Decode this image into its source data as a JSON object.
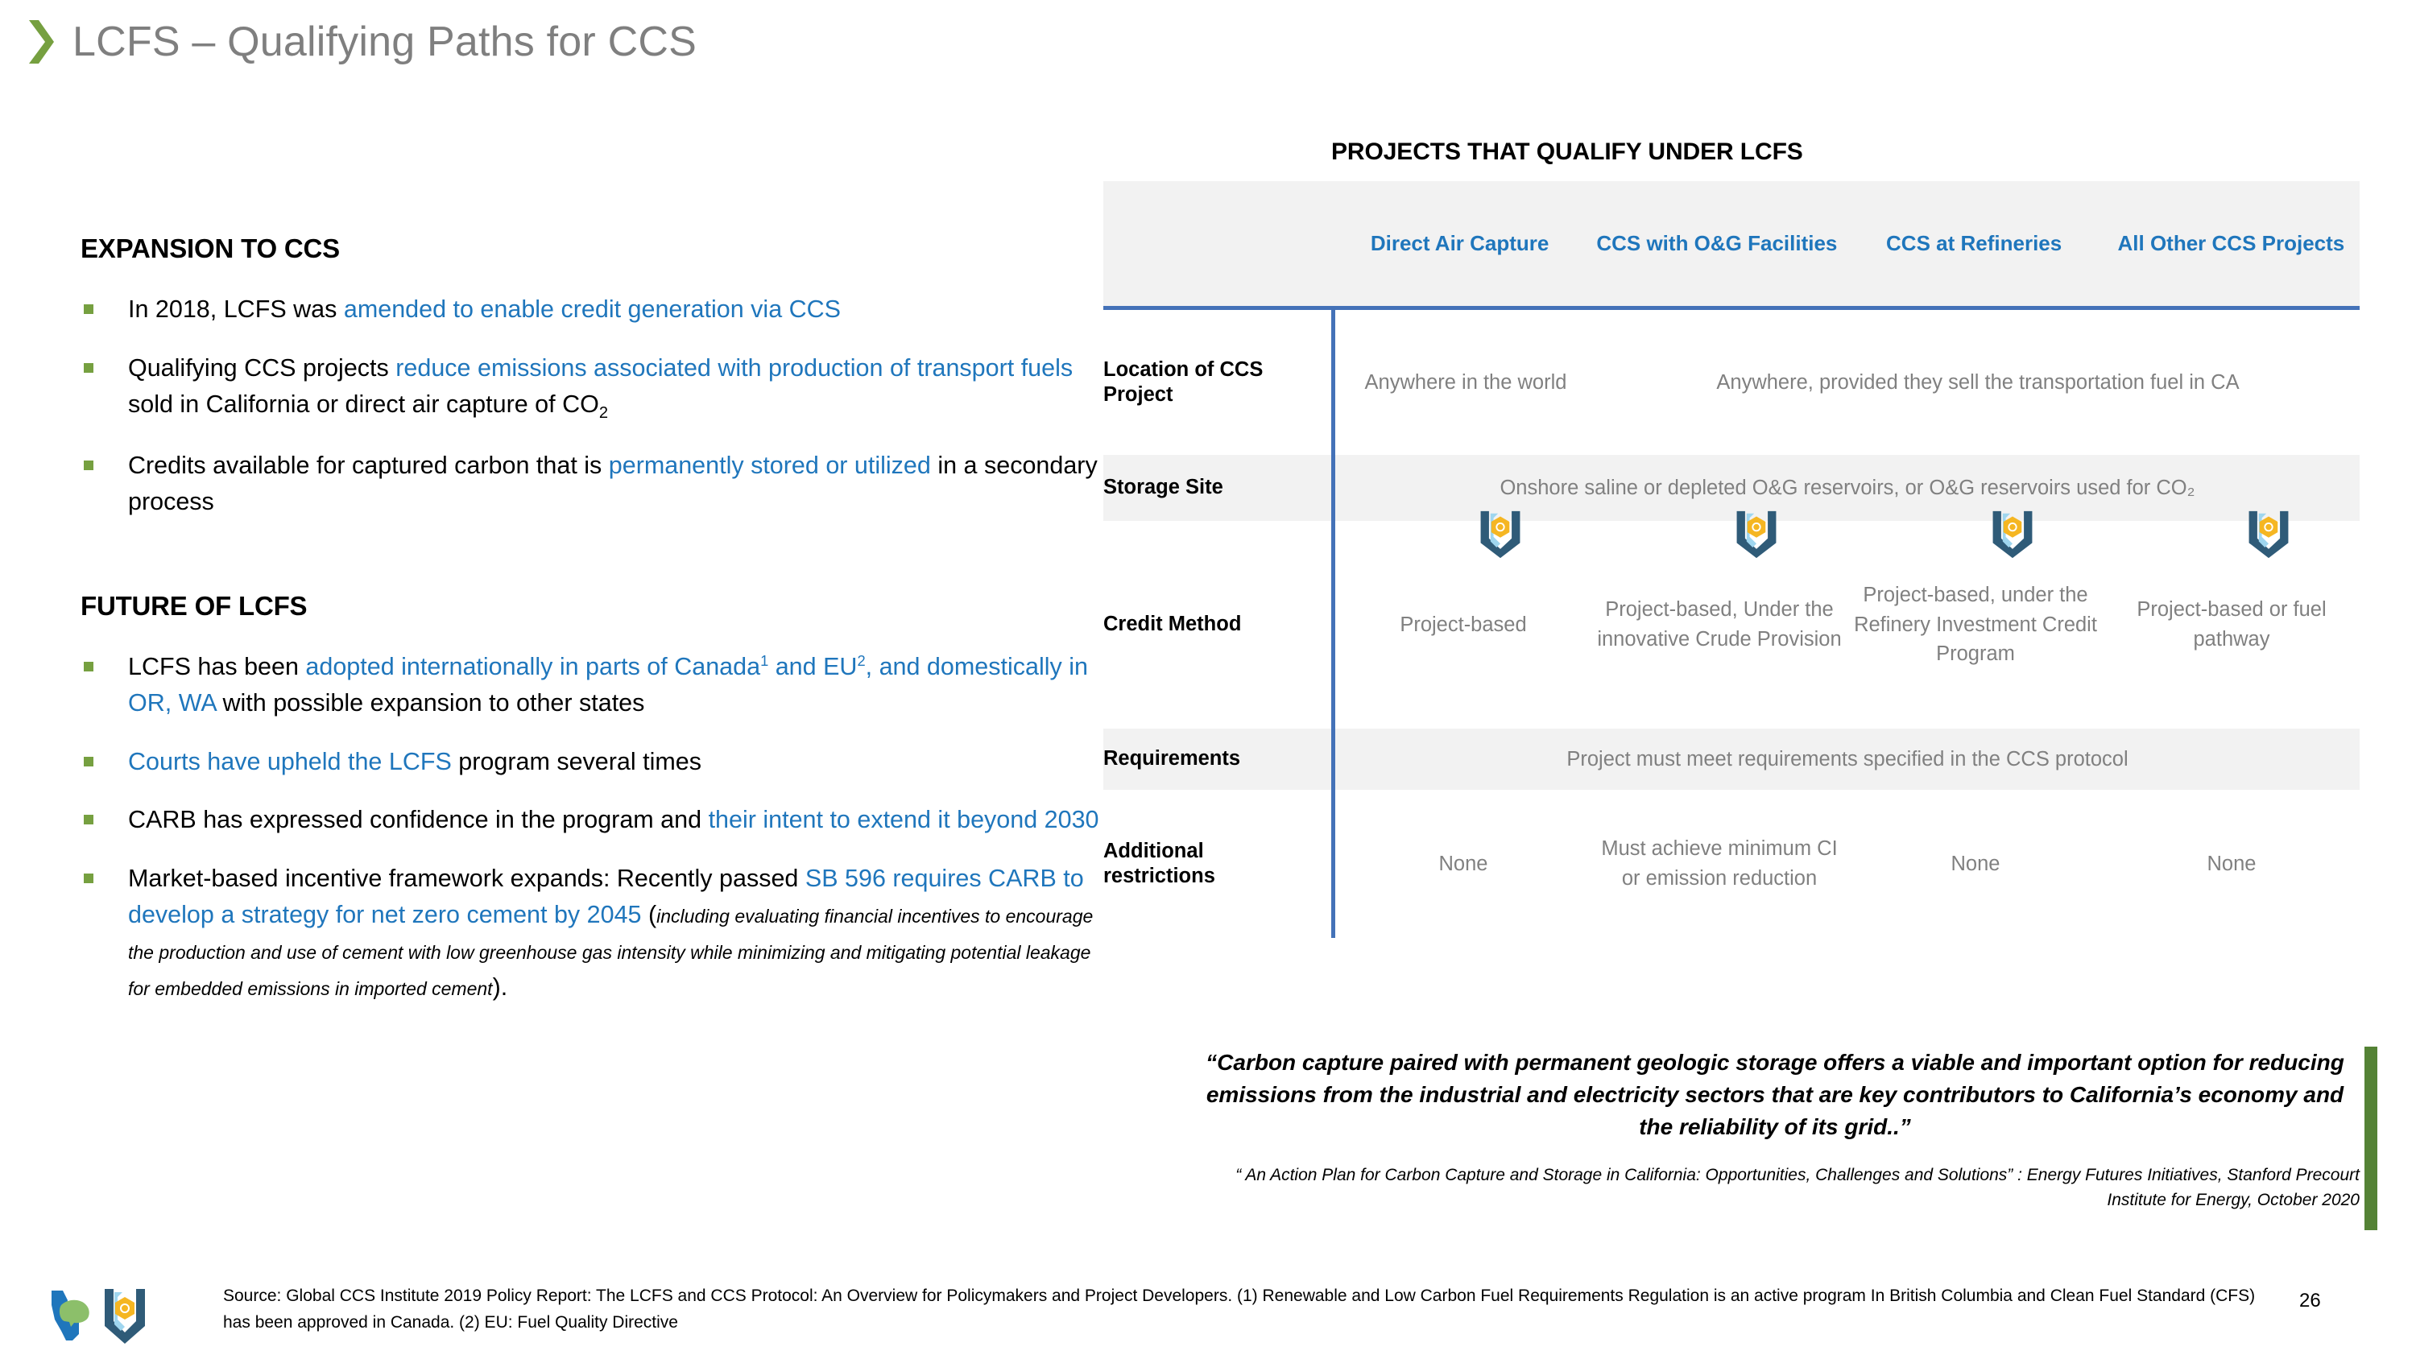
{
  "slide": {
    "title": "LCFS – Qualifying Paths for CCS",
    "page_number": "26",
    "accent_green": "#76a040",
    "accent_blue": "#1f76bc",
    "quote_bar_green": "#548235",
    "table_divider_blue": "#4472b8",
    "body_gray": "#808080"
  },
  "left": {
    "section1": {
      "heading": "EXPANSION TO CCS",
      "bullets": [
        {
          "parts": [
            {
              "text": "In 2018, LCFS was ",
              "style": "plain"
            },
            {
              "text": "amended to enable credit generation via CCS",
              "style": "highlight"
            }
          ]
        },
        {
          "parts": [
            {
              "text": "Qualifying CCS projects ",
              "style": "plain"
            },
            {
              "text": "reduce emissions associated with production of transport fuels",
              "style": "highlight"
            },
            {
              "text": " sold in California or direct air capture of CO",
              "style": "plain"
            },
            {
              "text": "2",
              "style": "subscript"
            }
          ]
        },
        {
          "parts": [
            {
              "text": "Credits available for captured carbon that is ",
              "style": "plain"
            },
            {
              "text": "permanently stored or utilized",
              "style": "highlight"
            },
            {
              "text": " in a secondary process",
              "style": "plain"
            }
          ]
        }
      ]
    },
    "section2": {
      "heading": "FUTURE OF LCFS",
      "bullets": [
        {
          "parts": [
            {
              "text": "LCFS has been ",
              "style": "plain"
            },
            {
              "text": "adopted internationally in parts of Canada",
              "style": "highlight"
            },
            {
              "text": "1",
              "style": "superscript-highlight"
            },
            {
              "text": " and EU",
              "style": "highlight"
            },
            {
              "text": "2",
              "style": "superscript-highlight"
            },
            {
              "text": ", and domestically in OR, WA",
              "style": "highlight"
            },
            {
              "text": " with possible expansion to other states",
              "style": "plain"
            }
          ]
        },
        {
          "parts": [
            {
              "text": "Courts have upheld the LCFS",
              "style": "highlight"
            },
            {
              "text": " program several times",
              "style": "plain"
            }
          ]
        },
        {
          "parts": [
            {
              "text": "CARB has expressed confidence in the program and ",
              "style": "plain"
            },
            {
              "text": "their intent to extend it beyond 2030",
              "style": "highlight"
            }
          ]
        },
        {
          "parts": [
            {
              "text": "Market-based incentive framework expands:  Recently passed ",
              "style": "plain"
            },
            {
              "text": "SB 596 requires CARB to develop a strategy for net zero cement by 2045",
              "style": "highlight"
            },
            {
              "text": " (",
              "style": "plain"
            },
            {
              "text": "including evaluating financial incentives to encourage the production and use of cement with low greenhouse gas intensity while minimizing and mitigating potential leakage for embedded emissions in imported cement",
              "style": "italic-small"
            },
            {
              "text": ").",
              "style": "plain"
            }
          ]
        }
      ]
    }
  },
  "matrix": {
    "title": "PROJECTS THAT QUALIFY UNDER LCFS",
    "columns": [
      "Direct Air Capture",
      "CCS with O&G Facilities",
      "CCS at Refineries",
      "All Other CCS Projects"
    ],
    "rows": [
      {
        "label": "Location of CCS Project",
        "shaded": false,
        "cells": [
          {
            "text": "Anywhere in the world",
            "span": 1,
            "icon": null
          },
          {
            "text": "Anywhere, provided they sell the transportation fuel in CA",
            "span": 3,
            "icon": null
          }
        ]
      },
      {
        "label": "Storage Site",
        "shaded": true,
        "cells": [
          {
            "text": "Onshore saline or depleted O&G reservoirs, or O&G reservoirs used for CO₂",
            "span": 4,
            "icon": null
          }
        ]
      },
      {
        "label": "Credit Method",
        "shaded": false,
        "cells": [
          {
            "text": "Project-based",
            "span": 1,
            "icon": "shield-icon"
          },
          {
            "text": "Project-based, Under the innovative Crude Provision",
            "span": 1,
            "icon": "shield-icon"
          },
          {
            "text": "Project-based, under the Refinery Investment Credit Program",
            "span": 1,
            "icon": "shield-icon"
          },
          {
            "text": "Project-based or fuel pathway",
            "span": 1,
            "icon": "shield-icon"
          }
        ]
      },
      {
        "label": "Requirements",
        "shaded": true,
        "cells": [
          {
            "text": "Project must meet requirements specified in the CCS protocol",
            "span": 4,
            "icon": null
          }
        ]
      },
      {
        "label": "Additional restrictions",
        "shaded": false,
        "cells": [
          {
            "text": "None",
            "span": 1,
            "icon": null
          },
          {
            "text": "Must achieve minimum CI or emission reduction",
            "span": 1,
            "icon": null
          },
          {
            "text": "None",
            "span": 1,
            "icon": null
          },
          {
            "text": "None",
            "span": 1,
            "icon": null
          }
        ]
      }
    ]
  },
  "quote": {
    "text": "“Carbon capture paired with permanent geologic storage offers a viable and important option for reducing emissions from the industrial and electricity sectors that are key contributors to California’s economy and the reliability of its grid..”",
    "source": "“ An Action Plan for Carbon Capture and Storage in California: Opportunities, Challenges and Solutions” : Energy Futures Initiatives, Stanford Precourt Institute for Energy, October 2020"
  },
  "footer": {
    "source": "Source: Global CCS Institute 2019 Policy Report: The LCFS and CCS Protocol: An Overview for Policymakers and Project Developers. (1) Renewable and Low Carbon Fuel Requirements Regulation is an active program In British Columbia and Clean Fuel Standard (CFS) has been approved in Canada. (2) EU: Fuel Quality Directive",
    "logos": [
      "california-bear-logo",
      "ccs-shield-logo"
    ]
  }
}
